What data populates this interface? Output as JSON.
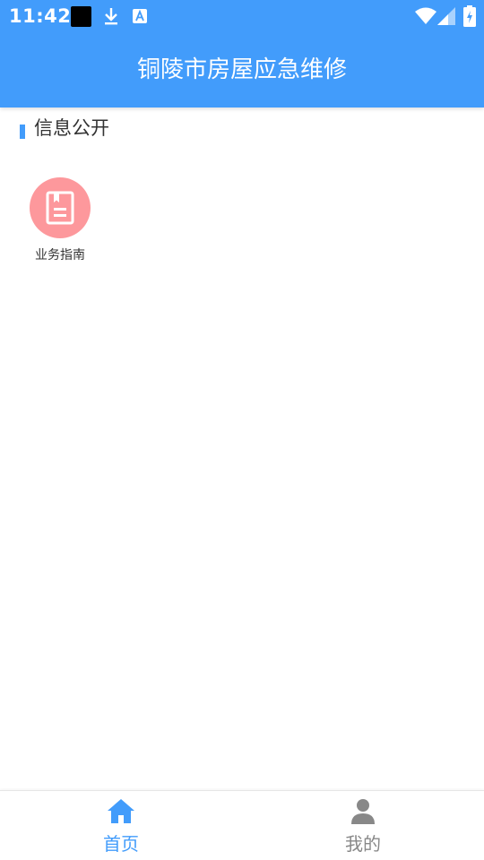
{
  "status_bar": {
    "time": "11:42",
    "icons": [
      "notification-square-icon",
      "download-icon",
      "font-a-icon",
      "wifi-icon",
      "signal-icon",
      "battery-icon"
    ]
  },
  "header": {
    "title": "铜陵市房屋应急维修"
  },
  "section": {
    "title": "信息公开"
  },
  "grid": {
    "items": [
      {
        "label": "业务指南",
        "icon": "document-icon",
        "color": "#fd989c"
      }
    ]
  },
  "tabbar": {
    "tabs": [
      {
        "label": "首页",
        "icon": "home-icon",
        "active": true
      },
      {
        "label": "我的",
        "icon": "person-icon",
        "active": false
      }
    ]
  },
  "colors": {
    "primary": "#429cfb",
    "icon_bg": "#fd989c",
    "inactive": "#888888"
  }
}
